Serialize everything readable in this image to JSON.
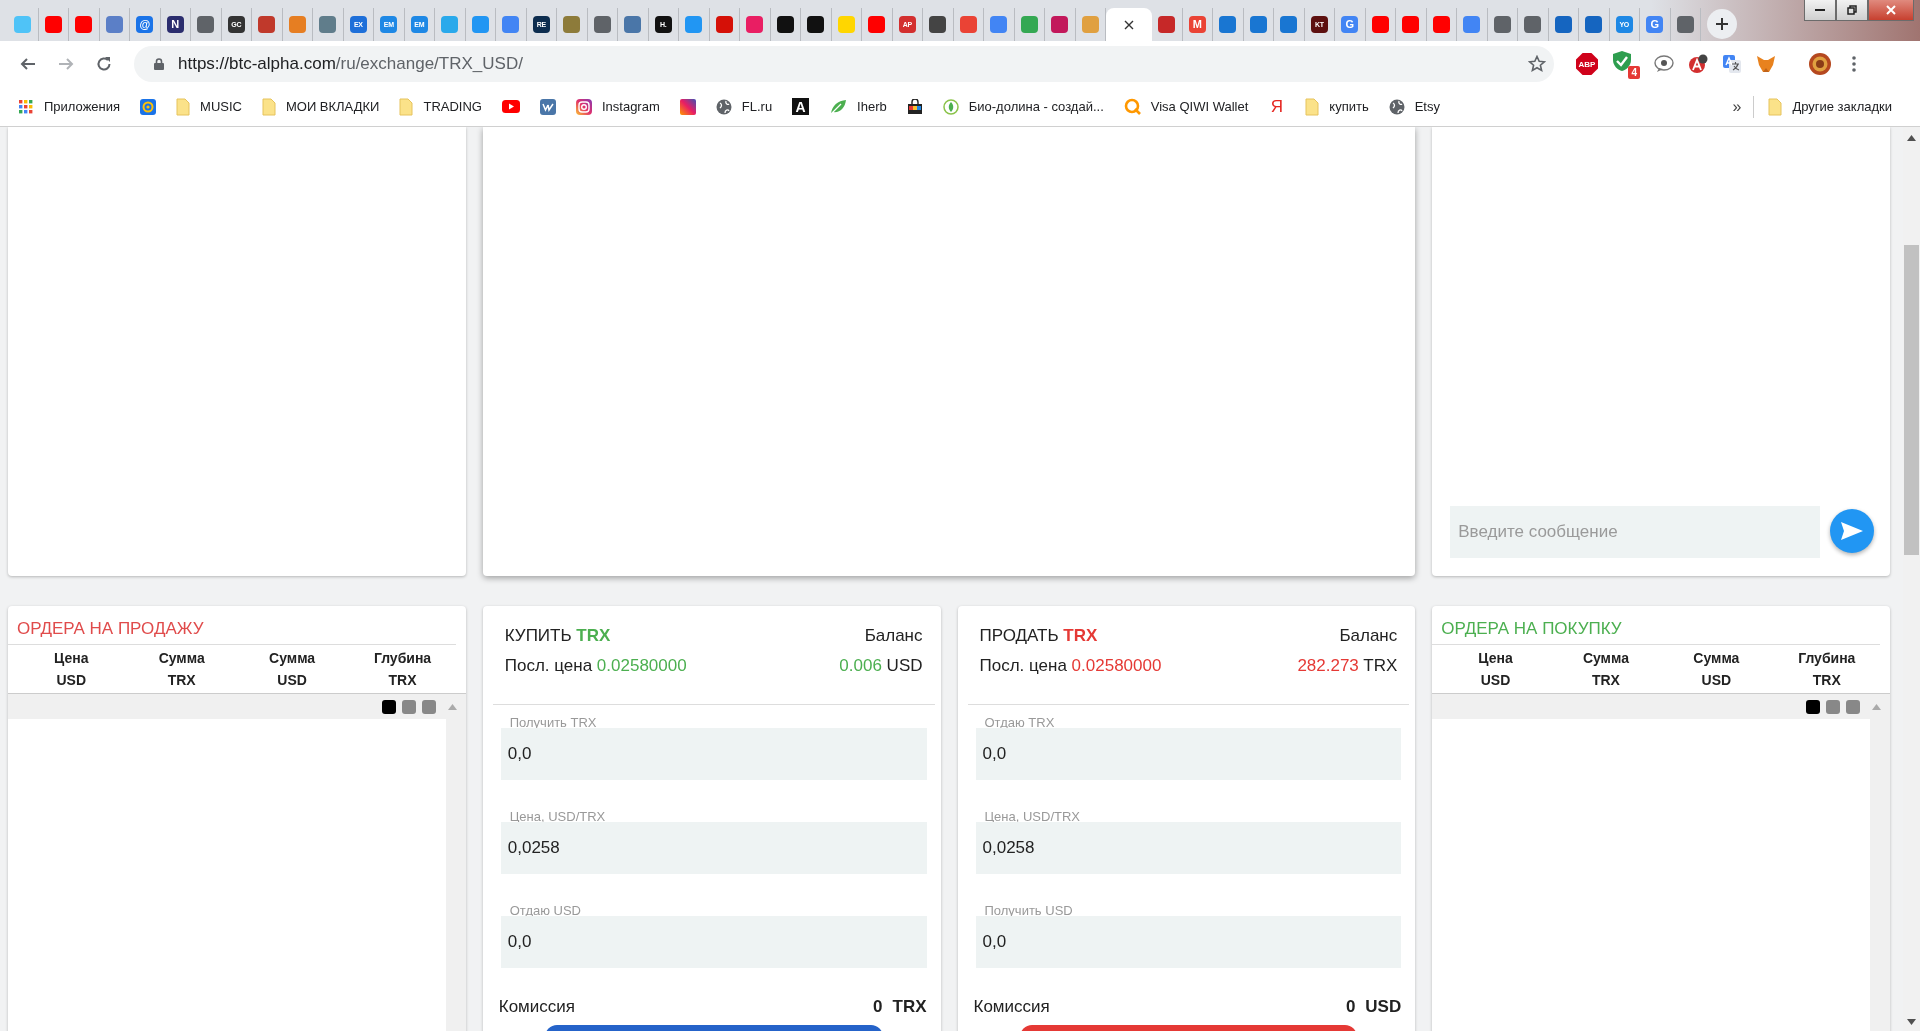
{
  "browser": {
    "tabs": [
      {
        "selected": false,
        "color": "#4fc3f7"
      },
      {
        "selected": false,
        "color": "#ff0000"
      },
      {
        "selected": false,
        "color": "#ff0000"
      },
      {
        "selected": false,
        "color": "#5b7fc7"
      },
      {
        "selected": false,
        "color": "#1a73e8",
        "glyph": "@"
      },
      {
        "selected": false,
        "color": "#2b2d6e",
        "glyph": "N"
      },
      {
        "selected": false,
        "color": "#5f6368"
      },
      {
        "selected": false,
        "color": "#333333",
        "glyph": "GC"
      },
      {
        "selected": false,
        "color": "#c0392b"
      },
      {
        "selected": false,
        "color": "#e67e22"
      },
      {
        "selected": false,
        "color": "#607d8b"
      },
      {
        "selected": false,
        "color": "#1e6fd9",
        "glyph": "EX"
      },
      {
        "selected": false,
        "color": "#1e88e5",
        "glyph": "EM"
      },
      {
        "selected": false,
        "color": "#1e88e5",
        "glyph": "EM"
      },
      {
        "selected": false,
        "color": "#29a9eb"
      },
      {
        "selected": false,
        "color": "#2196f3"
      },
      {
        "selected": false,
        "color": "#4285f4"
      },
      {
        "selected": false,
        "color": "#0d2d4f",
        "glyph": "RE"
      },
      {
        "selected": false,
        "color": "#8d7b3a"
      },
      {
        "selected": false,
        "color": "#5f6368"
      },
      {
        "selected": false,
        "color": "#4a76a8"
      },
      {
        "selected": false,
        "color": "#111111",
        "glyph": "H."
      },
      {
        "selected": false,
        "color": "#2196f3"
      },
      {
        "selected": false,
        "color": "#d51007"
      },
      {
        "selected": false,
        "color": "#e91e63"
      },
      {
        "selected": false,
        "color": "#111111"
      },
      {
        "selected": false,
        "color": "#111111"
      },
      {
        "selected": false,
        "color": "#ffd600"
      },
      {
        "selected": false,
        "color": "#ff0000"
      },
      {
        "selected": false,
        "color": "#d32f2f",
        "glyph": "AP"
      },
      {
        "selected": false,
        "color": "#444444"
      },
      {
        "selected": false,
        "color": "#ea4335"
      },
      {
        "selected": false,
        "color": "#4285f4"
      },
      {
        "selected": false,
        "color": "#34a853"
      },
      {
        "selected": false,
        "color": "#c2185b"
      },
      {
        "selected": false,
        "color": "#e0a040"
      },
      {
        "selected": true
      },
      {
        "selected": false,
        "color": "#c62828"
      },
      {
        "selected": false,
        "color": "#ea4335",
        "glyph": "M"
      },
      {
        "selected": false,
        "color": "#1976d2"
      },
      {
        "selected": false,
        "color": "#1976d2"
      },
      {
        "selected": false,
        "color": "#1976d2"
      },
      {
        "selected": false,
        "color": "#5d1010",
        "glyph": "KT"
      },
      {
        "selected": false,
        "color": "#4285f4",
        "glyph": "G"
      },
      {
        "selected": false,
        "color": "#ff0000"
      },
      {
        "selected": false,
        "color": "#ff0000"
      },
      {
        "selected": false,
        "color": "#ff0000"
      },
      {
        "selected": false,
        "color": "#4285f4"
      },
      {
        "selected": false,
        "color": "#5f6368"
      },
      {
        "selected": false,
        "color": "#5f6368"
      },
      {
        "selected": false,
        "color": "#1565c0"
      },
      {
        "selected": false,
        "color": "#1565c0"
      },
      {
        "selected": false,
        "color": "#1e88e5",
        "glyph": "YO"
      },
      {
        "selected": false,
        "color": "#4285f4",
        "glyph": "G"
      },
      {
        "selected": false,
        "color": "#5f6368"
      }
    ],
    "url": {
      "host": "https://btc-alpha.com",
      "path": "/ru/exchange/TRX_USD/"
    },
    "extensions": [
      {
        "kind": "abp",
        "glyph": "ABP"
      },
      {
        "kind": "shield",
        "badge": "4"
      },
      {
        "kind": "chat"
      },
      {
        "kind": "letter"
      },
      {
        "kind": "translate"
      },
      {
        "kind": "fox"
      },
      {
        "kind": "avatar"
      }
    ],
    "bookmarks": [
      {
        "kind": "apps",
        "label": "Приложения"
      },
      {
        "kind": "mail"
      },
      {
        "kind": "folder",
        "label": "MUSIC"
      },
      {
        "kind": "folder",
        "label": "МОИ ВКЛАДКИ"
      },
      {
        "kind": "folder",
        "label": "TRADING"
      },
      {
        "kind": "youtube"
      },
      {
        "kind": "vk"
      },
      {
        "kind": "instagram",
        "label": "Instagram"
      },
      {
        "kind": "tile"
      },
      {
        "kind": "globe",
        "label": "FL.ru"
      },
      {
        "kind": "letter",
        "glyph": "A"
      },
      {
        "kind": "leaf",
        "label": "Iherb"
      },
      {
        "kind": "bag"
      },
      {
        "kind": "bio",
        "label": "Био-долина - создай..."
      },
      {
        "kind": "qiwi",
        "label": "Visa QIWI Wallet"
      },
      {
        "kind": "yandex",
        "glyph": "Я"
      },
      {
        "kind": "folder",
        "label": "купить"
      },
      {
        "kind": "globe",
        "label": "Etsy"
      }
    ],
    "more_bookmarks": "»",
    "other_bookmarks": {
      "kind": "folder",
      "label": "Другие закладки"
    }
  },
  "chat": {
    "placeholder": "Введите сообщение"
  },
  "sell_orders": {
    "kind": "sell",
    "title": "ОРДЕРА НА ПРОДАЖУ",
    "columns": [
      {
        "label": "Цена",
        "unit": "USD"
      },
      {
        "label": "Сумма",
        "unit": "TRX"
      },
      {
        "label": "Сумма",
        "unit": "USD"
      },
      {
        "label": "Глубина",
        "unit": "TRX"
      }
    ],
    "views": [
      {
        "selected": true
      },
      {
        "selected": false
      },
      {
        "selected": false
      }
    ]
  },
  "buy_form": {
    "kind": "buy",
    "action": "КУПИТЬ",
    "asset": "TRX",
    "balance_label": "Баланс",
    "last_price_label": "Посл. цена",
    "last_price": "0.02580000",
    "balance": "0.006",
    "balance_unit": "USD",
    "fields": [
      {
        "label": "Получить TRX",
        "value": "0,0"
      },
      {
        "label": "Цена, USD/TRX",
        "value": "0,0258"
      },
      {
        "label": "Отдаю USD",
        "value": "0,0"
      }
    ],
    "commission_label": "Комиссия",
    "commission": "0",
    "commission_unit": "TRX"
  },
  "sell_form": {
    "kind": "sell",
    "action": "ПРОДАТЬ",
    "asset": "TRX",
    "balance_label": "Баланс",
    "last_price_label": "Посл. цена",
    "last_price": "0.02580000",
    "balance": "282.273",
    "balance_unit": "TRX",
    "fields": [
      {
        "label": "Отдаю TRX",
        "value": "0,0"
      },
      {
        "label": "Цена, USD/TRX",
        "value": "0,0258"
      },
      {
        "label": "Получить USD",
        "value": "0,0"
      }
    ],
    "commission_label": "Комиссия",
    "commission": "0",
    "commission_unit": "USD"
  },
  "buy_orders": {
    "kind": "buy",
    "title": "ОРДЕРА НА ПОКУПКУ",
    "columns": [
      {
        "label": "Цена",
        "unit": "USD"
      },
      {
        "label": "Сумма",
        "unit": "TRX"
      },
      {
        "label": "Сумма",
        "unit": "USD"
      },
      {
        "label": "Глубина",
        "unit": "TRX"
      }
    ],
    "views": [
      {
        "selected": true
      },
      {
        "selected": false
      },
      {
        "selected": false
      }
    ]
  }
}
